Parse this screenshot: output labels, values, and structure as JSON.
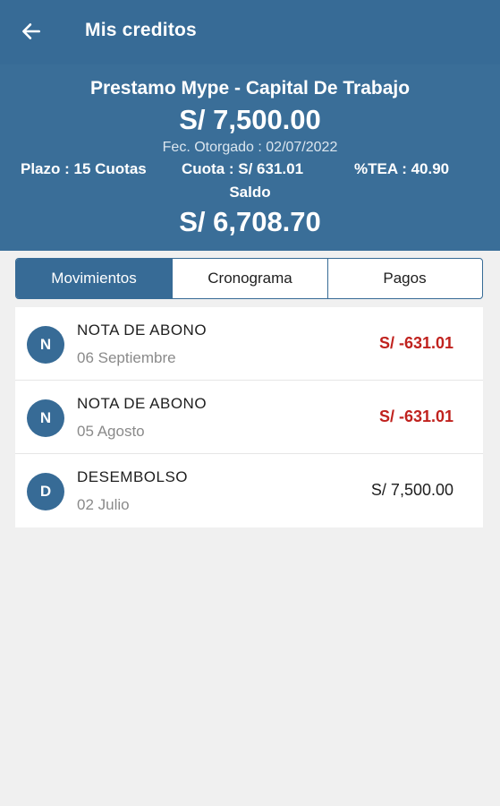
{
  "appbar": {
    "back_icon": "arrow-left-icon",
    "title": "Mis creditos"
  },
  "summary": {
    "product_name": "Prestamo Mype - Capital De Trabajo",
    "amount": "S/ 7,500.00",
    "granted_date": "Fec. Otorgado : 02/07/2022",
    "term": "Plazo : 15 Cuotas",
    "installment": "Cuota : S/ 631.01",
    "tea": "%TEA : 40.90",
    "balance_label": "Saldo",
    "balance": "S/ 6,708.70"
  },
  "tabs": [
    {
      "label": "Movimientos",
      "active": true
    },
    {
      "label": "Cronograma",
      "active": false
    },
    {
      "label": "Pagos",
      "active": false
    }
  ],
  "movements": [
    {
      "initial": "N",
      "title": "NOTA DE ABONO",
      "date": "06 Septiembre",
      "amount": "S/ -631.01",
      "type": "negative"
    },
    {
      "initial": "N",
      "title": "NOTA DE ABONO",
      "date": "05 Agosto",
      "amount": "S/ -631.01",
      "type": "negative"
    },
    {
      "initial": "D",
      "title": "DESEMBOLSO",
      "date": "02 Julio",
      "amount": "S/ 7,500.00",
      "type": "positive"
    }
  ],
  "colors": {
    "primary": "#376b96",
    "negative_amount": "#c0221e",
    "background": "#f0f0f0"
  }
}
